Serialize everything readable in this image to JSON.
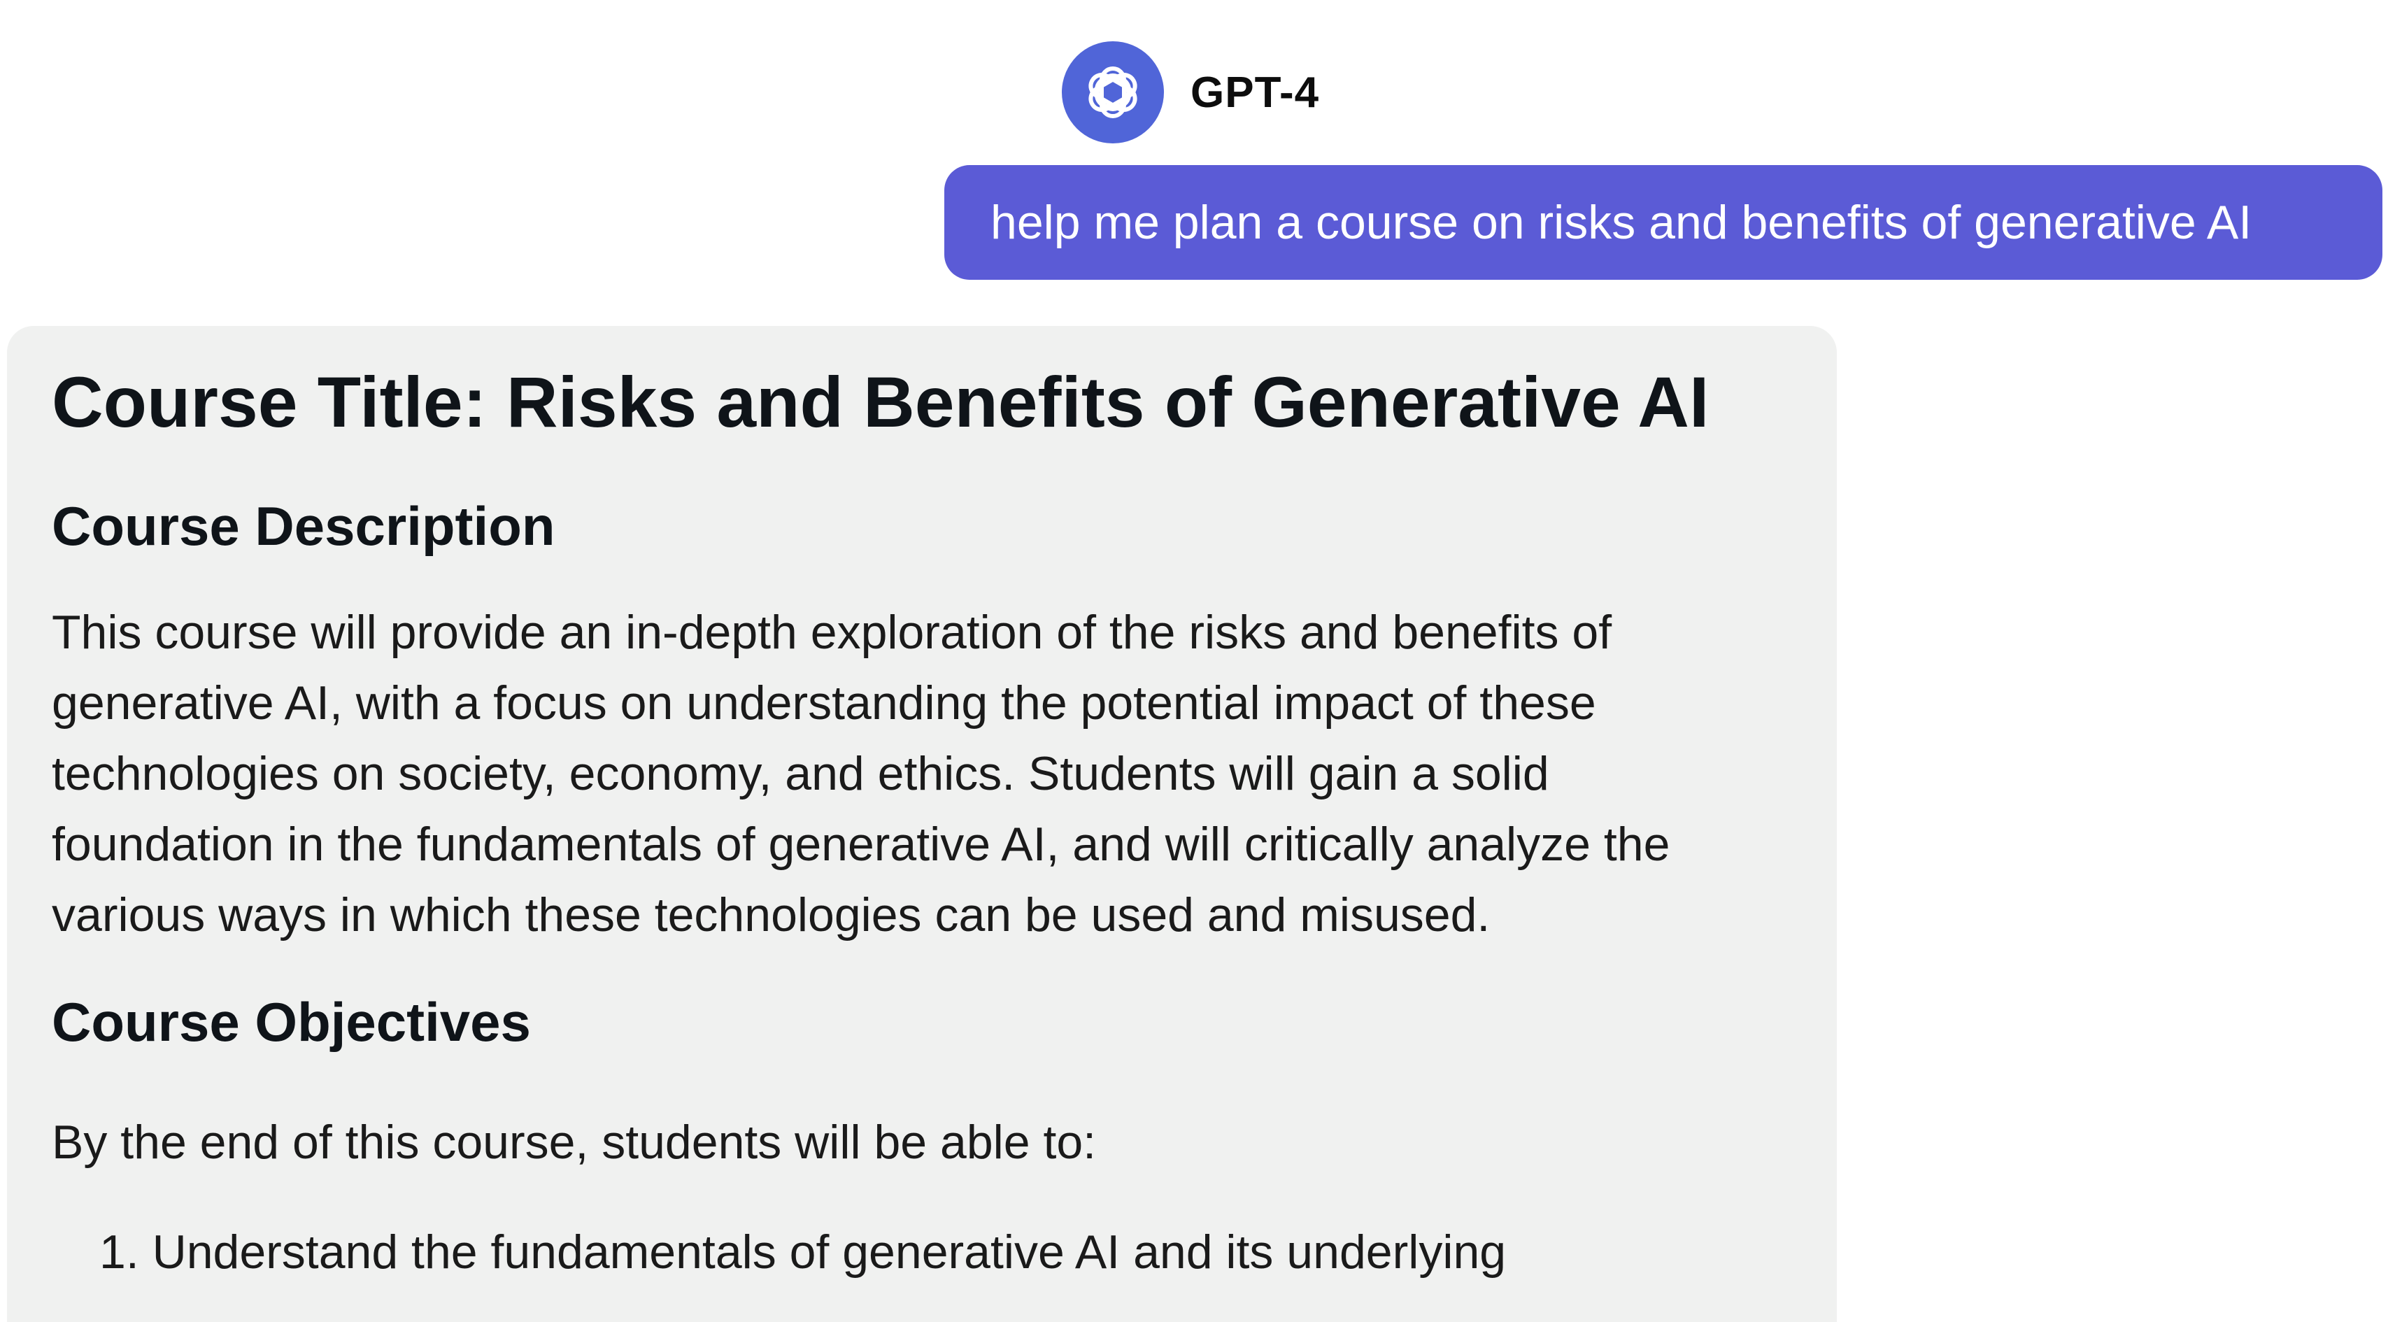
{
  "header": {
    "model_name": "GPT-4",
    "avatar_icon": "openai-logo-icon",
    "avatar_color": "#5065d8"
  },
  "user_message": {
    "text": "help me plan a course on risks and benefits of generative AI",
    "bubble_color": "#5b5bd6"
  },
  "assistant": {
    "background": "#f0f1f0",
    "title": "Course Title: Risks and Benefits of Generative AI",
    "description_heading": "Course Description",
    "description_lines": [
      "This course will provide an in-depth exploration of the risks and benefits of",
      "generative AI, with a focus on understanding the potential impact of these",
      "technologies on society, economy, and ethics. Students will gain a solid",
      "foundation in the fundamentals of generative AI, and will critically analyze the",
      "various ways in which these technologies can be used and misused."
    ],
    "objectives_heading": "Course Objectives",
    "objectives_intro": "By the end of this course, students will be able to:",
    "objectives": [
      "1. Understand the fundamentals of generative AI and its underlying"
    ]
  }
}
